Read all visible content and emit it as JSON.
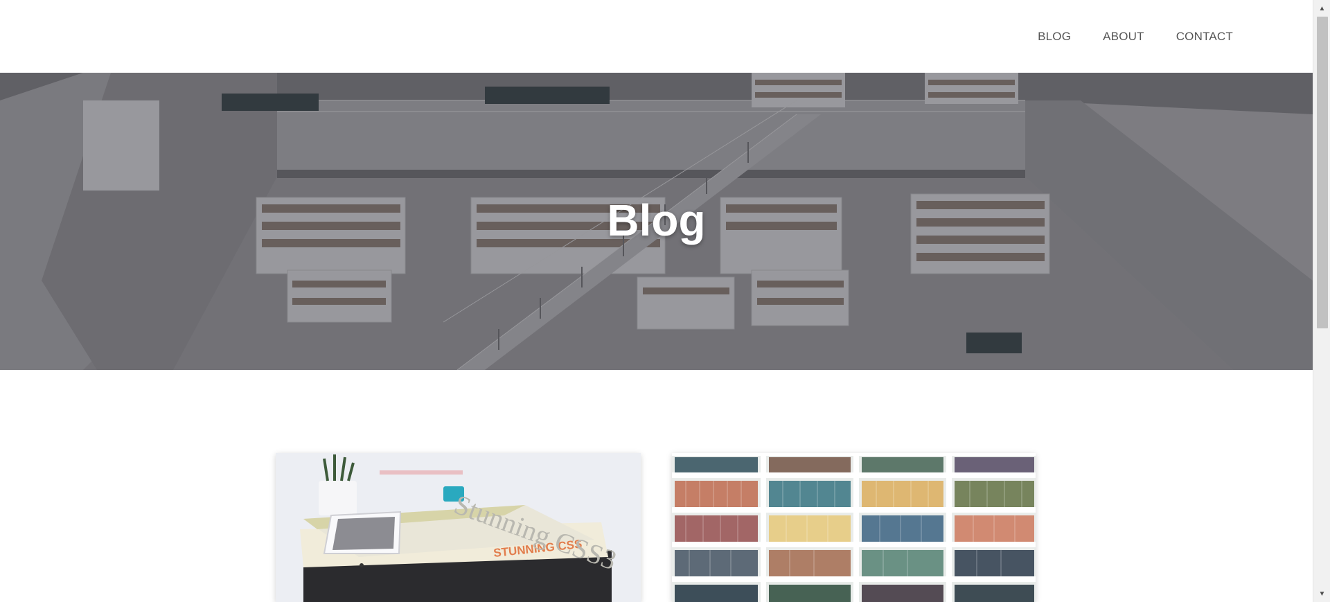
{
  "nav": {
    "items": [
      {
        "label": "BLOG"
      },
      {
        "label": "ABOUT"
      },
      {
        "label": "CONTACT"
      }
    ]
  },
  "hero": {
    "title": "Blog",
    "image": "library-atrium-photo"
  },
  "cards": [
    {
      "image": "books-and-phone-photo",
      "cover_text": "STUNNING CSS",
      "spine_text": "Stunning CSS3"
    },
    {
      "image": "bookshelves-photo"
    }
  ],
  "scrollbar": {
    "up_icon": "triangle-up",
    "down_icon": "triangle-down"
  }
}
